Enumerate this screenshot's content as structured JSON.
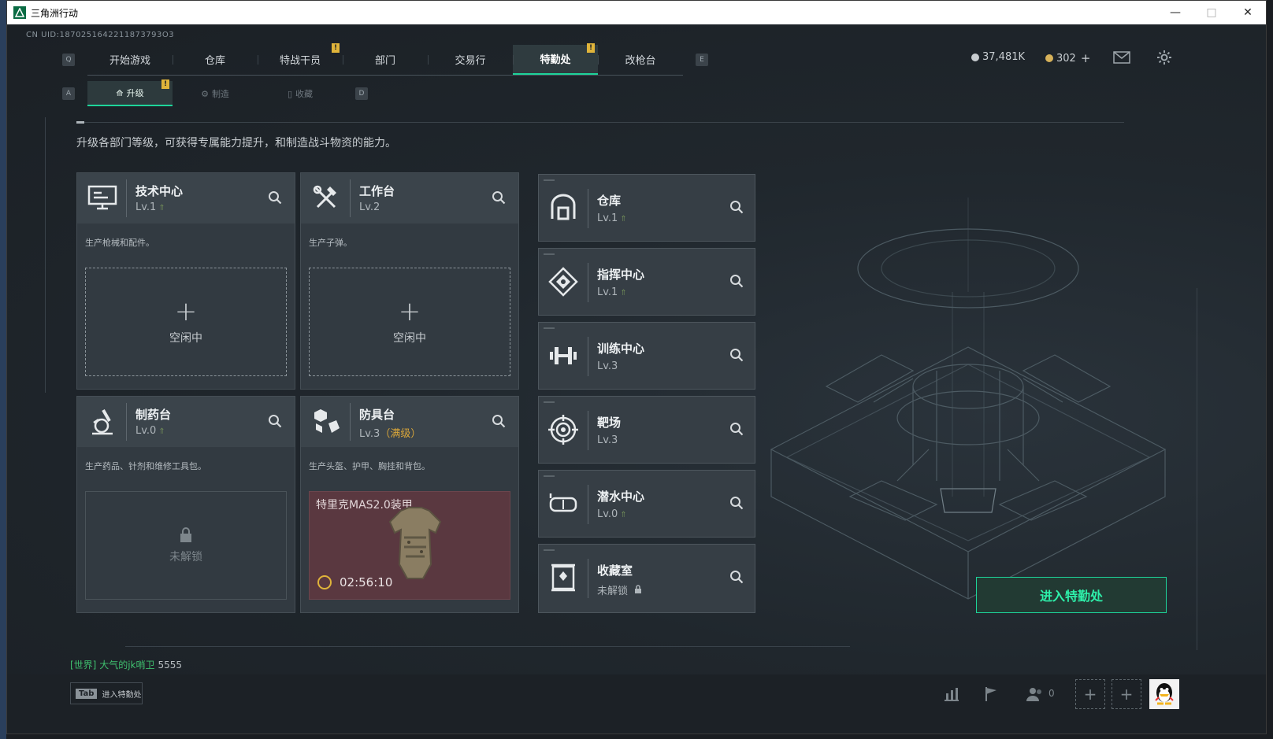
{
  "window": {
    "title": "三角洲行动",
    "minimize": "—",
    "maximize": "□",
    "close": "✕"
  },
  "uid": "CN UID:1870251642211873793O3",
  "nav": {
    "left_key": "Q",
    "right_key": "E",
    "tabs": [
      {
        "label": "开始游戏"
      },
      {
        "label": "仓库"
      },
      {
        "label": "特战干员",
        "notif": "!"
      },
      {
        "label": "部门"
      },
      {
        "label": "交易行"
      },
      {
        "label": "特勤处",
        "notif": "!",
        "active": true
      },
      {
        "label": "改枪台"
      }
    ]
  },
  "currency": {
    "coins": "37,481K",
    "premium": "302",
    "premium_add": "+"
  },
  "subnav": {
    "left_key": "A",
    "right_key": "D",
    "tabs": [
      {
        "label": "升级",
        "notif": "!",
        "active": true
      },
      {
        "label": "制造"
      },
      {
        "label": "收藏"
      }
    ]
  },
  "description": "升级各部门等级，可获得专属能力提升，和制造战斗物资的能力。",
  "cards": {
    "tech": {
      "name": "技术中心",
      "level": "Lv.1",
      "sub": "生产枪械和配件。",
      "slot": "空闲中"
    },
    "workbench": {
      "name": "工作台",
      "level": "Lv.2",
      "sub": "生产子弹。",
      "slot": "空闲中"
    },
    "pharmacy": {
      "name": "制药台",
      "level": "Lv.0",
      "sub": "生产药品、针剂和维修工具包。",
      "slot": "未解锁"
    },
    "armor": {
      "name": "防具台",
      "level": "Lv.3",
      "level_max": "（满级）",
      "sub": "生产头盔、护甲、胸挂和背包。",
      "craft_name": "特里克MAS2.0装甲",
      "craft_timer": "02:56:10"
    }
  },
  "right_cards": [
    {
      "name": "仓库",
      "level": "Lv.1",
      "upgradeable": true
    },
    {
      "name": "指挥中心",
      "level": "Lv.1",
      "upgradeable": true
    },
    {
      "name": "训练中心",
      "level": "Lv.3",
      "upgradeable": false
    },
    {
      "name": "靶场",
      "level": "Lv.3",
      "upgradeable": false
    },
    {
      "name": "潜水中心",
      "level": "Lv.0",
      "upgradeable": true
    },
    {
      "name": "收藏室",
      "level": "未解锁",
      "upgradeable": false
    }
  ],
  "enter_button": "进入特勤处",
  "chat": {
    "channel": "[世界]",
    "user": "大气的jk哨卫",
    "message": "5555"
  },
  "bottom": {
    "tab_key": "Tab",
    "tab_label": "进入特勤处",
    "friends_count": "0"
  },
  "colors": {
    "accent": "#1ed49a",
    "notif": "#e0b43a",
    "craft_bg": "#5a3840"
  }
}
